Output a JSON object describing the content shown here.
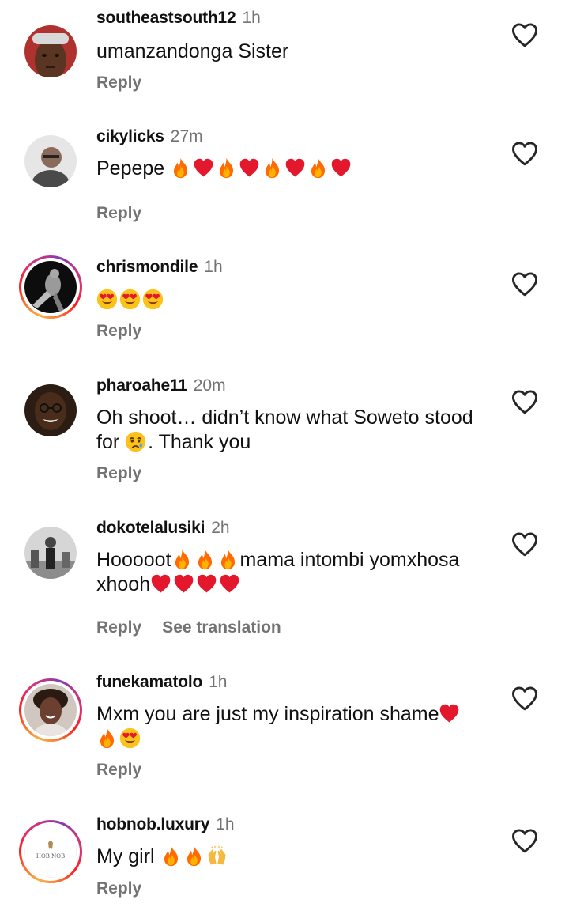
{
  "comments": [
    {
      "username": "southeastsouth12",
      "time": "1h",
      "text": "umanzandonga Sister",
      "emojis": [],
      "reply_label": "Reply",
      "has_story_ring": false,
      "like_icon": "heart-outline-icon"
    },
    {
      "username": "cikylicks",
      "time": "27m",
      "text": "Pepepe",
      "emojis": [
        "fire",
        "red-heart",
        "fire",
        "red-heart",
        "fire",
        "red-heart",
        "fire",
        "red-heart"
      ],
      "reply_label": "Reply",
      "has_story_ring": false,
      "like_icon": "heart-outline-icon"
    },
    {
      "username": "chrismondile",
      "time": "1h",
      "text": "",
      "emojis": [
        "heart-eyes",
        "heart-eyes",
        "heart-eyes"
      ],
      "reply_label": "Reply",
      "has_story_ring": true,
      "like_icon": "heart-outline-icon"
    },
    {
      "username": "pharoahe11",
      "time": "20m",
      "text_line1": "Oh shoot… didn’t know what Soweto stood",
      "text_line2_pre": "for",
      "text_line2_post": ". Thank you",
      "emojis": [
        "crying-face"
      ],
      "reply_label": "Reply",
      "has_story_ring": false,
      "like_icon": "heart-outline-icon"
    },
    {
      "username": "dokotelalusiki",
      "time": "2h",
      "text_line1_pre": "Hooooot",
      "text_line1_post": "mama intombi yomxhosa",
      "text_line2": "xhooh",
      "emojis": [
        "fire",
        "fire",
        "fire",
        "red-heart",
        "red-heart",
        "red-heart",
        "red-heart"
      ],
      "reply_label": "Reply",
      "translate_label": "See translation",
      "has_story_ring": false,
      "like_icon": "heart-outline-icon"
    },
    {
      "username": "funekamatolo",
      "time": "1h",
      "text": "Mxm you are just my inspiration shame",
      "emojis": [
        "red-heart",
        "fire",
        "heart-eyes"
      ],
      "reply_label": "Reply",
      "has_story_ring": true,
      "like_icon": "heart-outline-icon"
    },
    {
      "username": "hobnob.luxury",
      "time": "1h",
      "text": "My girl",
      "emojis": [
        "fire",
        "fire",
        "raising-hands"
      ],
      "avatar_logo_text": "HOB NOB",
      "reply_label": "Reply",
      "has_story_ring": true,
      "like_icon": "heart-outline-icon"
    }
  ],
  "colors": {
    "text": "#111111",
    "secondary": "#737373",
    "background": "#ffffff"
  }
}
